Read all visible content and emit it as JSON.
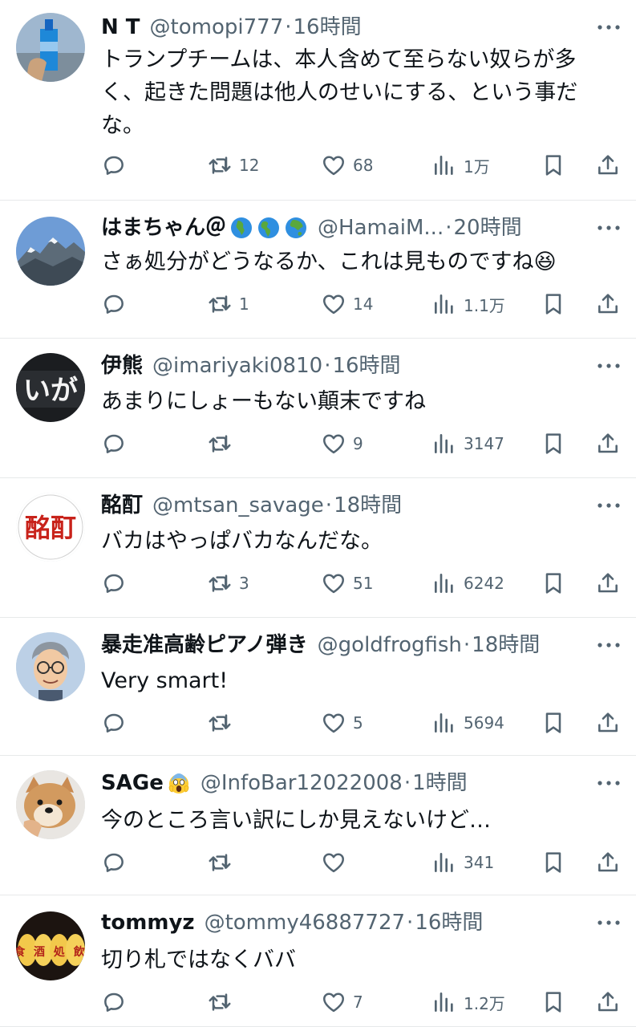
{
  "tweets": [
    {
      "name": "N T",
      "emojis": [],
      "handle": "@tomopi777",
      "time": "16時間",
      "text": "トランプチームは、本人含めて至らない奴らが多く、起きた問題は他人のせいにする、という事だな。",
      "replies": "",
      "retweets": "12",
      "likes": "68",
      "views": "1万",
      "avatar": "blue-bottle-photo"
    },
    {
      "name": "はまちゃん＠",
      "emojis": [
        "globe-africa-icon",
        "globe-americas-icon",
        "globe-asia-icon"
      ],
      "handle": "@HamaiM...",
      "time": "20時間",
      "text": "さぁ処分がどうなるか、これは見ものですね😆",
      "replies": "",
      "retweets": "1",
      "likes": "14",
      "views": "1.1万",
      "avatar": "mountain-photo"
    },
    {
      "name": "伊熊",
      "emojis": [],
      "handle": "@imariyaki0810",
      "time": "16時間",
      "text": "あまりにしょーもない顛末ですね",
      "replies": "",
      "retweets": "",
      "likes": "9",
      "views": "3147",
      "avatar": "shop-sign-ika",
      "avatar_text": "いが"
    },
    {
      "name": "酩酊",
      "emojis": [],
      "handle": "@mtsan_savage",
      "time": "18時間",
      "text": "バカはやっぱバカなんだな。",
      "replies": "",
      "retweets": "3",
      "likes": "51",
      "views": "6242",
      "avatar": "red-seal-meitei",
      "avatar_text": "酩酊"
    },
    {
      "name": "暴走准高齢ピアノ弾き",
      "emojis": [],
      "handle": "@goldfrogfish",
      "time": "18時間",
      "text": "Very smart!",
      "replies": "",
      "retweets": "",
      "likes": "5",
      "views": "5694",
      "avatar": "man-with-glasses-illustration"
    },
    {
      "name": "SAGe",
      "emojis": [
        "screaming-face-icon"
      ],
      "handle": "@InfoBar12022008",
      "time": "1時間",
      "text": "今のところ言い訳にしか見えないけど…",
      "replies": "",
      "retweets": "",
      "likes": "",
      "views": "341",
      "avatar": "shiba-dog-photo"
    },
    {
      "name": "tommyz",
      "emojis": [],
      "handle": "@tommy46887727",
      "time": "16時間",
      "text": "切り札ではなくババ",
      "replies": "",
      "retweets": "",
      "likes": "7",
      "views": "1.2万",
      "avatar": "lanterns-photo",
      "avatar_text": "食 酒 処 飲"
    }
  ],
  "ui": {
    "time_separator": "·"
  },
  "colors": {
    "text": "#0f1419",
    "secondary": "#536471",
    "divider": "#e7e9ea"
  }
}
